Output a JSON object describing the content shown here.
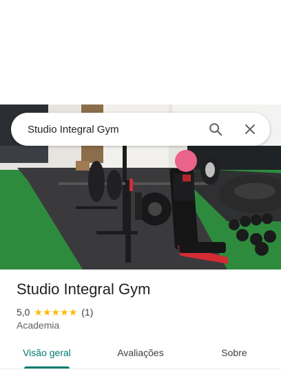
{
  "search": {
    "query": "Studio Integral Gym"
  },
  "icons": {
    "search": "search-icon",
    "close": "close-icon",
    "star": "star-icon"
  },
  "place": {
    "title": "Studio Integral Gym",
    "rating": "5,0",
    "stars": 5,
    "review_count": "(1)",
    "category": "Academia"
  },
  "tabs": [
    {
      "label": "Visão geral",
      "active": true
    },
    {
      "label": "Avaliações",
      "active": false
    },
    {
      "label": "Sobre",
      "active": false
    }
  ],
  "colors": {
    "accent": "#00796b",
    "star": "#fbbc04",
    "floor_green": "#2e8b3e",
    "mat": "#3a3a3c"
  }
}
